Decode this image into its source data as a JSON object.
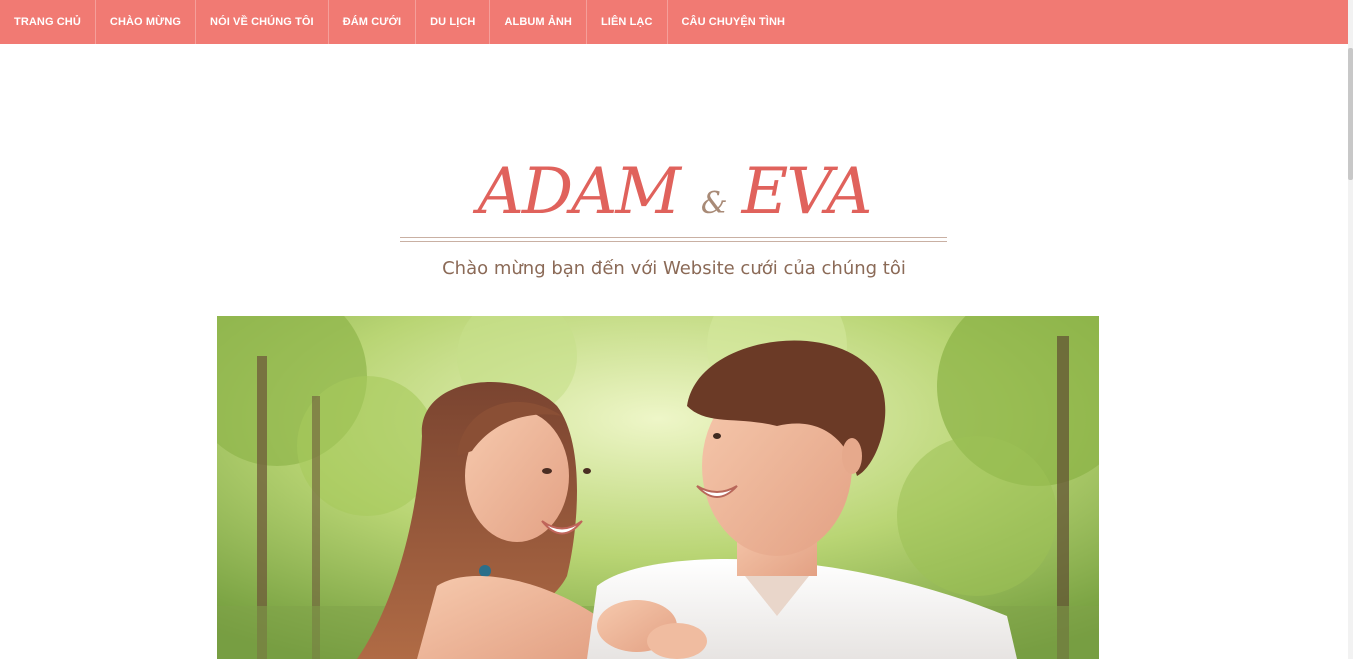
{
  "nav": {
    "items": [
      {
        "label": "TRANG CHỦ"
      },
      {
        "label": "CHÀO MỪNG"
      },
      {
        "label": "NÓI VỀ CHÚNG TÔI"
      },
      {
        "label": "ĐÁM CƯỚI"
      },
      {
        "label": "DU LỊCH"
      },
      {
        "label": "ALBUM ẢNH"
      },
      {
        "label": "LIÊN LẠC"
      },
      {
        "label": "CÂU CHUYỆN TÌNH"
      }
    ]
  },
  "header": {
    "groom": "ADAM",
    "ampersand": "&",
    "bride": "EVA",
    "subtitle": "Chào mừng bạn đến với Website cưới của chúng tôi"
  },
  "colors": {
    "nav_bg": "#f17a73",
    "title": "#e0625c",
    "subtitle": "#8b6a57"
  }
}
